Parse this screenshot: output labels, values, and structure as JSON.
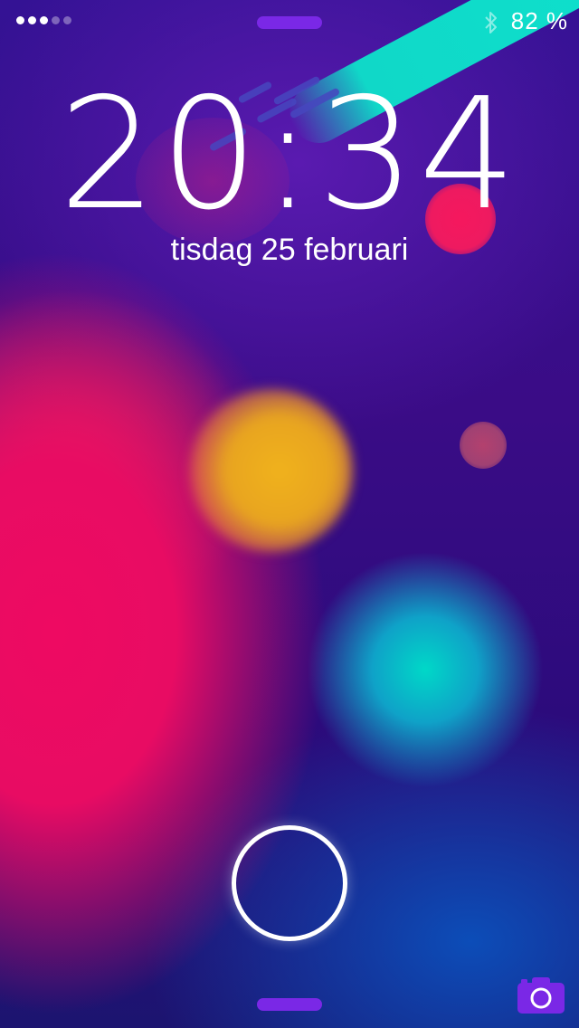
{
  "status_bar": {
    "signal_dots": [
      true,
      true,
      true,
      false,
      false
    ],
    "bluetooth": "bluetooth-icon",
    "battery_text": "82 %"
  },
  "lock_screen": {
    "time": "20:34",
    "date": "tisdag 25 februari"
  },
  "controls": {
    "top_grabber": "notification-center-grabber",
    "unlock_ring": "unlock-ring",
    "bottom_grabber": "control-center-grabber",
    "camera": "camera-icon"
  },
  "colors": {
    "accent": "#7a28e6",
    "wallpaper_pink": "#ee0a62",
    "wallpaper_cyan": "#00d8c8",
    "wallpaper_yellow": "#f0b21c",
    "wallpaper_purple": "#3a0c86"
  }
}
